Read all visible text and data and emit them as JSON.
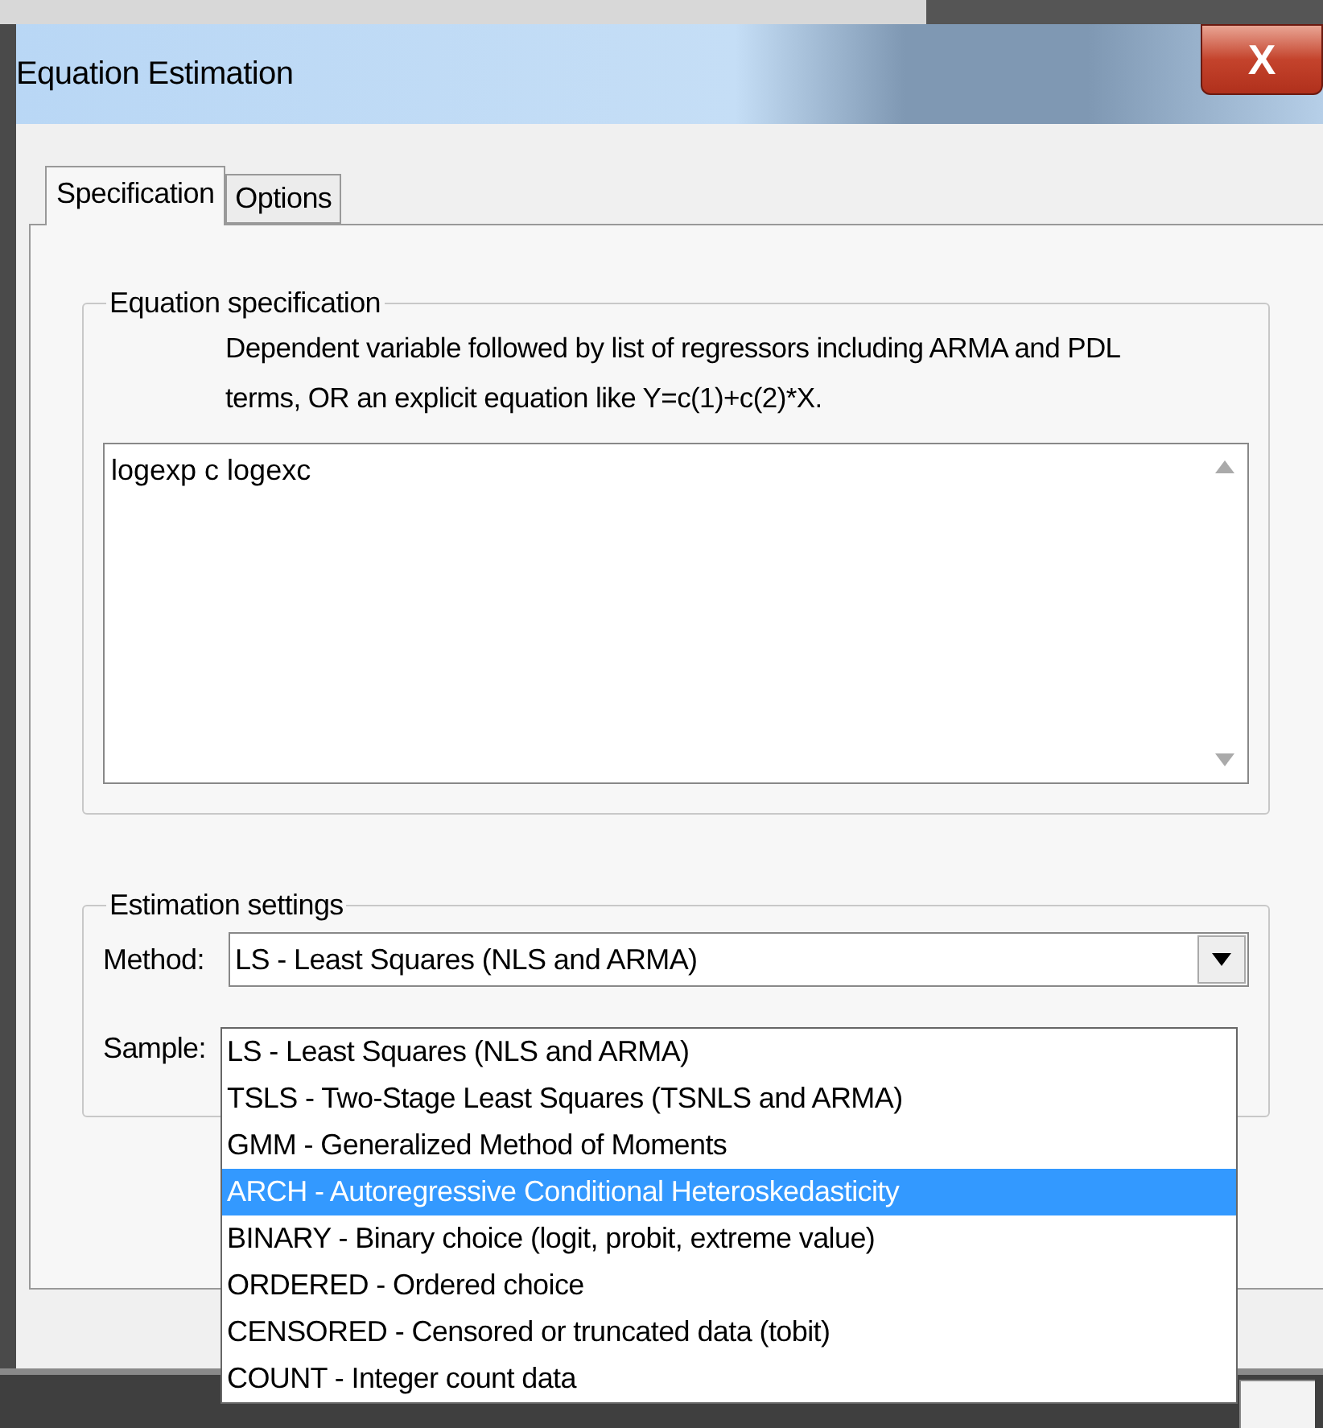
{
  "window": {
    "title": "Equation Estimation",
    "close_label": "X"
  },
  "tabs": [
    {
      "label": "Specification",
      "selected": true
    },
    {
      "label": "Options",
      "selected": false
    }
  ],
  "equation_specification": {
    "legend": "Equation specification",
    "description": "Dependent variable followed by list of regressors including ARMA and PDL terms, OR an explicit equation like Y=c(1)+c(2)*X.",
    "value": "logexp c logexc"
  },
  "estimation_settings": {
    "legend": "Estimation settings",
    "method_label": "Method:",
    "method_value": "LS  -  Least Squares (NLS and ARMA)",
    "sample_label": "Sample:",
    "expanded": true,
    "options": [
      {
        "label": "LS  -  Least Squares (NLS and ARMA)",
        "selected": false
      },
      {
        "label": "TSLS  -  Two-Stage Least Squares (TSNLS and ARMA)",
        "selected": false
      },
      {
        "label": "GMM  -  Generalized Method of Moments",
        "selected": false
      },
      {
        "label": "ARCH  -  Autoregressive Conditional Heteroskedasticity",
        "selected": true
      },
      {
        "label": "BINARY  -  Binary choice (logit, probit, extreme value)",
        "selected": false
      },
      {
        "label": "ORDERED  -  Ordered choice",
        "selected": false
      },
      {
        "label": "CENSORED  -  Censored or truncated data (tobit)",
        "selected": false
      },
      {
        "label": "COUNT  -  Integer count data",
        "selected": false
      }
    ]
  }
}
